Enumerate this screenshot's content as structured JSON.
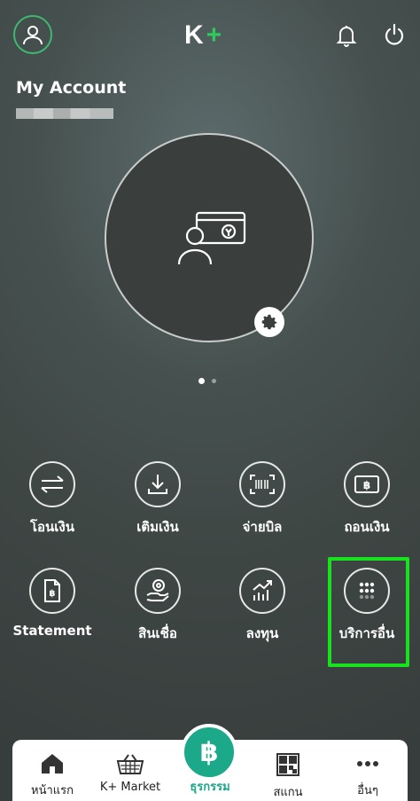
{
  "header": {
    "logo_k": "K",
    "logo_plus": "+",
    "account_title": "My Account"
  },
  "carousel": {
    "total_pages": 2,
    "active_page": 1
  },
  "services": [
    {
      "label": "โอนเงิน",
      "icon": "transfer-icon"
    },
    {
      "label": "เติมเงิน",
      "icon": "topup-icon"
    },
    {
      "label": "จ่ายบิล",
      "icon": "barcode-icon"
    },
    {
      "label": "ถอนเงิน",
      "icon": "withdraw-icon"
    },
    {
      "label": "Statement",
      "icon": "statement-icon"
    },
    {
      "label": "สินเชื่อ",
      "icon": "loan-icon"
    },
    {
      "label": "ลงทุน",
      "icon": "invest-icon"
    },
    {
      "label": "บริการอื่น",
      "icon": "more-services-icon"
    }
  ],
  "bottom_nav": [
    {
      "label": "หน้าแรก",
      "icon": "home-icon"
    },
    {
      "label": "K+ Market",
      "icon": "basket-icon"
    },
    {
      "label": "ธุรกรรม",
      "icon": "baht-icon",
      "active": true
    },
    {
      "label": "สแกน",
      "icon": "qr-icon"
    },
    {
      "label": "อื่นๆ",
      "icon": "more-icon"
    }
  ],
  "center_button_symbol": "฿",
  "colors": {
    "brand_green": "#2ec95c",
    "active_teal": "#1ca98a",
    "highlight_green": "#17e21d"
  }
}
